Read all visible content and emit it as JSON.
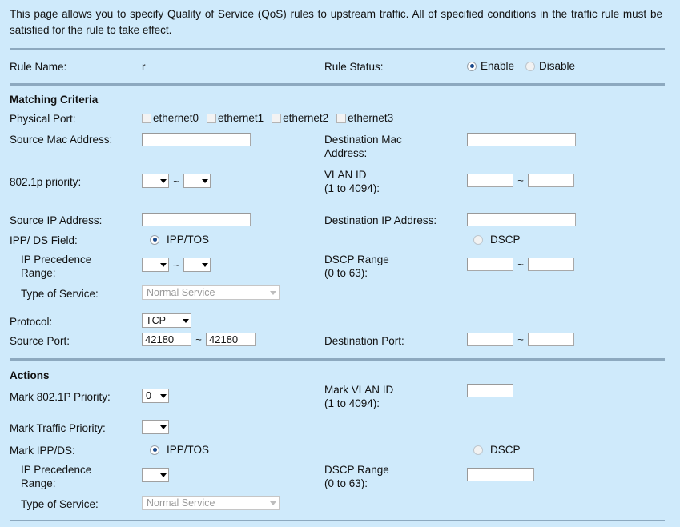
{
  "intro": "This page allows you to specify Quality of Service (QoS) rules to upstream traffic. All of specified conditions in the traffic rule must be satisfied for the rule to take effect.",
  "rule": {
    "name_label": "Rule Name:",
    "name_value": "r",
    "status_label": "Rule Status:",
    "enable_label": "Enable",
    "disable_label": "Disable",
    "status_selected": "Enable"
  },
  "matching": {
    "heading": "Matching Criteria",
    "physical_port_label": "Physical Port:",
    "ports": [
      {
        "label": "ethernet0",
        "checked": false
      },
      {
        "label": "ethernet1",
        "checked": false
      },
      {
        "label": "ethernet2",
        "checked": false
      },
      {
        "label": "ethernet3",
        "checked": false
      }
    ],
    "source_mac_label": "Source Mac Address:",
    "source_mac_value": "",
    "dest_mac_label_line1": "Destination Mac",
    "dest_mac_label_line2": "Address:",
    "dest_mac_value": "",
    "dot1p_label": "802.1p priority:",
    "dot1p_from": "",
    "dot1p_to": "",
    "vlan_label_line1": "VLAN ID",
    "vlan_label_line2": "(1 to 4094):",
    "vlan_from": "",
    "vlan_to": "",
    "source_ip_label": "Source IP Address:",
    "source_ip_value": "",
    "dest_ip_label": "Destination IP Address:",
    "dest_ip_value": "",
    "ipp_ds_label": "IPP/ DS Field:",
    "ipp_tos_label": "IPP/TOS",
    "dscp_label": "DSCP",
    "ipp_ds_selected": "IPP/TOS",
    "ip_prec_label_line1": "IP Precedence",
    "ip_prec_label_line2": "Range:",
    "ip_prec_from": "",
    "ip_prec_to": "",
    "dscp_range_label_line1": "DSCP Range",
    "dscp_range_label_line2": "(0 to 63):",
    "dscp_from": "",
    "dscp_to": "",
    "tos_label": "Type of Service:",
    "tos_value": "Normal Service",
    "protocol_label": "Protocol:",
    "protocol_value": "TCP",
    "source_port_label": "Source Port:",
    "source_port_from": "42180",
    "source_port_to": "42180",
    "dest_port_label": "Destination Port:",
    "dest_port_from": "",
    "dest_port_to": ""
  },
  "actions": {
    "heading": "Actions",
    "mark_8021p_label": "Mark 802.1P Priority:",
    "mark_8021p_value": "0",
    "mark_vlan_label_line1": "Mark VLAN ID",
    "mark_vlan_label_line2": "(1 to 4094):",
    "mark_vlan_value": "",
    "mark_traffic_label": "Mark Traffic Priority:",
    "mark_traffic_value": "",
    "mark_ipp_ds_label": "Mark IPP/DS:",
    "ipp_tos_label": "IPP/TOS",
    "dscp_label": "DSCP",
    "mark_ipp_selected": "IPP/TOS",
    "ip_prec_label_line1": "IP Precedence",
    "ip_prec_label_line2": "Range:",
    "ip_prec_value": "",
    "dscp_range_label_line1": "DSCP Range",
    "dscp_range_label_line2": "(0 to 63):",
    "dscp_value": "",
    "tos_label": "Type of Service:",
    "tos_value": "Normal Service"
  },
  "colors": {
    "background": "#cfeafb",
    "divider": "#8da9bf",
    "radio_dot": "#17478a",
    "disabled_text": "#9b9b9b"
  },
  "tilde": "~"
}
